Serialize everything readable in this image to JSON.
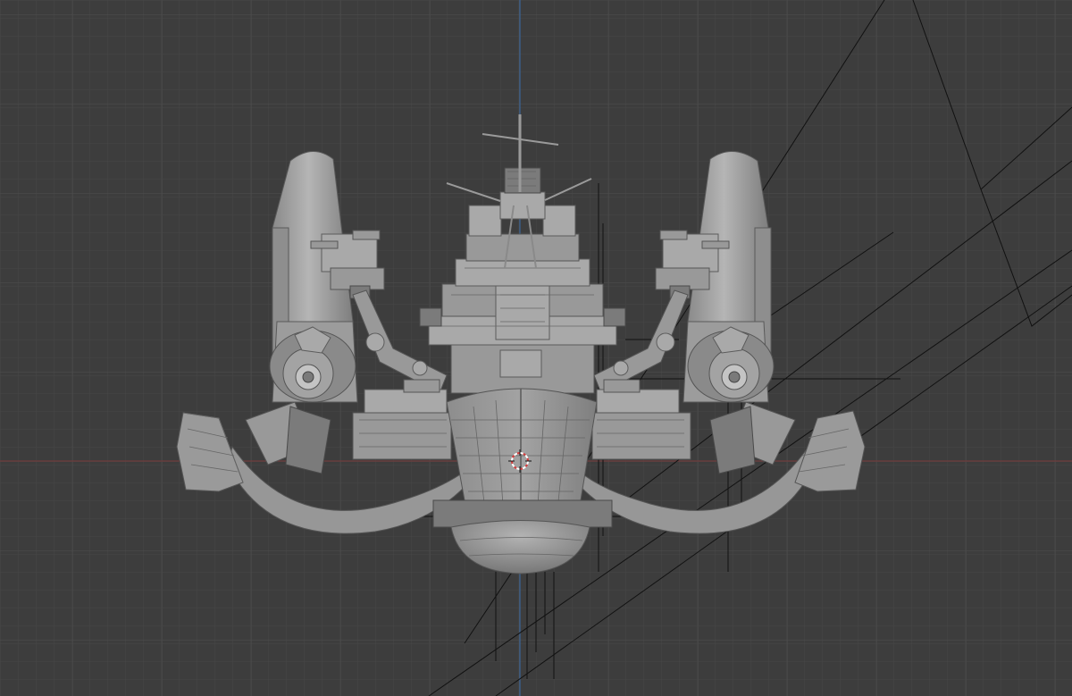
{
  "viewport": {
    "background_color": "#3d3d3d",
    "grid_minor_color": "#444444",
    "grid_major_color": "#4a4a4a",
    "axis_x_color": "#8a3b3b",
    "axis_y_color": "#3c6aa0",
    "model_color": "#a0a0a0",
    "wire_color": "#111111",
    "cursor_colors": [
      "#d33c3c",
      "#ffffff"
    ],
    "icon": "3d-cursor-icon",
    "model": "battleship-mech-front-view"
  }
}
